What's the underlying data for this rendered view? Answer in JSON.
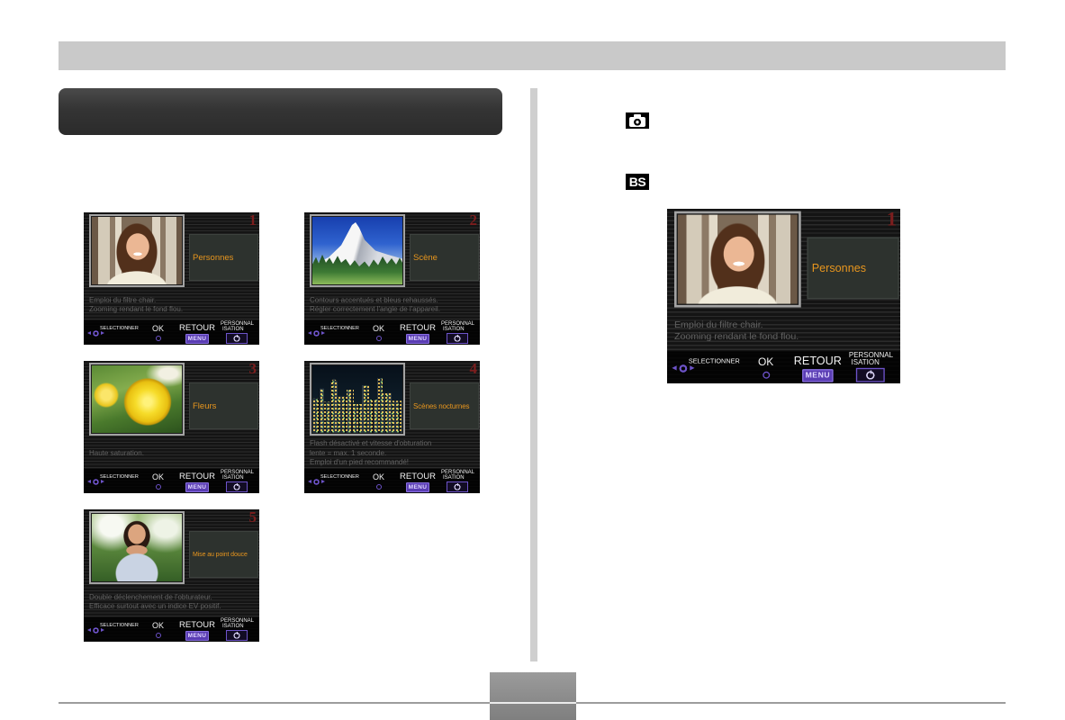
{
  "page": {
    "mode_icon": "camera-icon",
    "bs_icon_label": "BS"
  },
  "screen_footer": {
    "select_label": "SELECTIONNER",
    "ok_label": "OK",
    "back_label": "RETOUR",
    "menu_key_label": "MENU",
    "custom_label_line1": "PERSONNAL",
    "custom_label_line2": "ISATION",
    "select_icon": "arrow-select-icon",
    "ok_icon": "ring-button-icon",
    "custom_icon": "self-timer-icon"
  },
  "screens": [
    {
      "number": "1",
      "label": "Personnes",
      "description": [
        "Emploi du filtre chair.",
        "Zooming rendant le fond flou."
      ]
    },
    {
      "number": "2",
      "label": "Scène",
      "description": [
        "Contours accentués et bleus rehaussés.",
        "Régler correctement l'angle de l'appareil."
      ]
    },
    {
      "number": "3",
      "label": "Fleurs",
      "description": [
        "Haute saturation."
      ]
    },
    {
      "number": "4",
      "label": "Scènes nocturnes",
      "description": [
        "Flash désactivé et vitesse d'obturation",
        "lente = max. 1 seconde.",
        "Emploi d'un pied recommandé!"
      ]
    },
    {
      "number": "5",
      "label": "Mise au point douce",
      "description": [
        "Double déclenchement de l'obturateur.",
        "Efficace surtout avec un indice EV positif."
      ]
    }
  ],
  "preview": {
    "number": "1",
    "label": "Personnes",
    "description": [
      "Emploi du filtre chair.",
      "Zooming rendant le fond flou."
    ]
  },
  "colors": {
    "accent_purple": "#6d53c9",
    "scene_number_red": "#7c1e1e",
    "label_orange": "#e8961e",
    "description_gray": "#626262",
    "header_bar_gray": "#c9c9c9",
    "section_box_dark": "#343434"
  }
}
